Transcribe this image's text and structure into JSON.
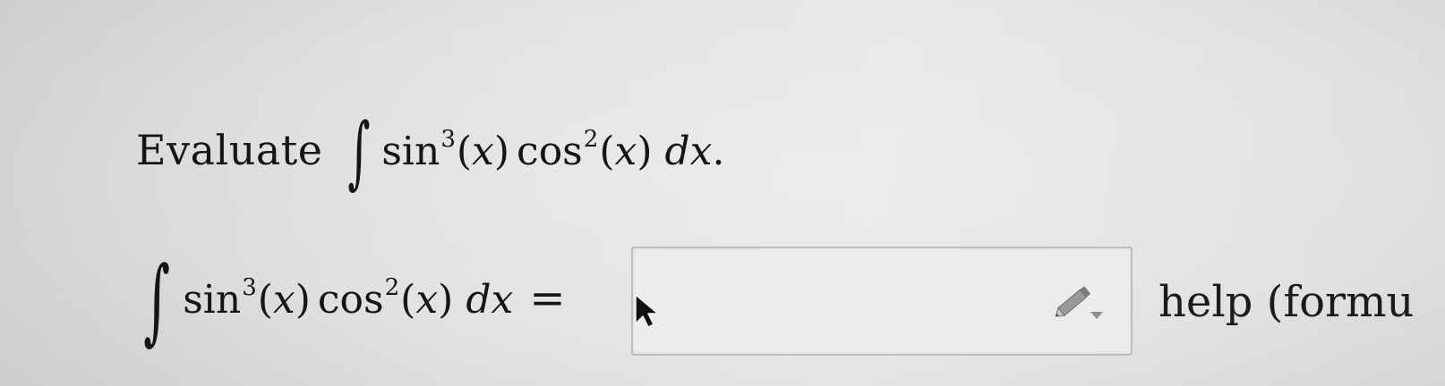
{
  "prompt": {
    "evaluate_label": "Evaluate",
    "integral_sign": "∫",
    "fn1": "sin",
    "exp1": "3",
    "open1": "(",
    "var1": "x",
    "close1": ")",
    "fn2": "cos",
    "exp2": "2",
    "open2": "(",
    "var2": "x",
    "close2": ")",
    "d": "d",
    "dvar": "x",
    "period": "."
  },
  "answer": {
    "integral_sign": "∫",
    "fn1": "sin",
    "exp1": "3",
    "open1": "(",
    "var1": "x",
    "close1": ")",
    "fn2": "cos",
    "exp2": "2",
    "open2": "(",
    "var2": "x",
    "close2": ")",
    "d": "d",
    "dvar": "x",
    "equals": "=",
    "input_value": ""
  },
  "help_link": {
    "label": "help (formu"
  },
  "icons": {
    "cursor": "mouse-pointer-icon",
    "editor": "pencil-icon"
  }
}
